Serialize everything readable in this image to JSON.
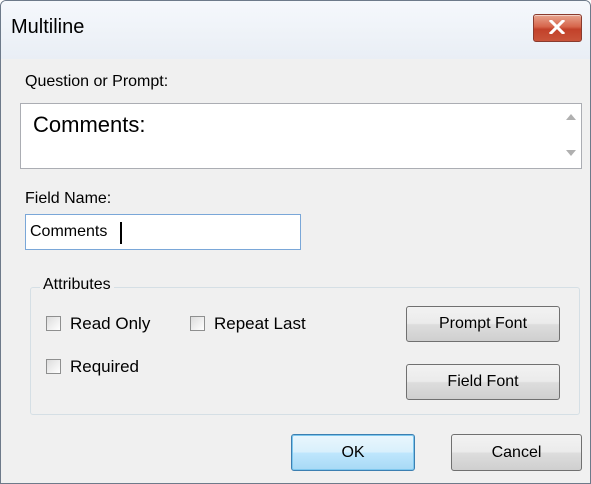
{
  "window": {
    "title": "Multiline"
  },
  "prompt": {
    "label": "Question or Prompt:",
    "value": "Comments:"
  },
  "field": {
    "label": "Field Name:",
    "value": "Comments"
  },
  "attributes": {
    "legend": "Attributes",
    "read_only_label": "Read Only",
    "repeat_last_label": "Repeat Last",
    "required_label": "Required",
    "prompt_font_label": "Prompt Font",
    "field_font_label": "Field Font"
  },
  "footer": {
    "ok_label": "OK",
    "cancel_label": "Cancel"
  },
  "colors": {
    "close_button": "#c9543a",
    "default_button_border": "#3c7fb1",
    "focus_border": "#7aa7d8"
  }
}
